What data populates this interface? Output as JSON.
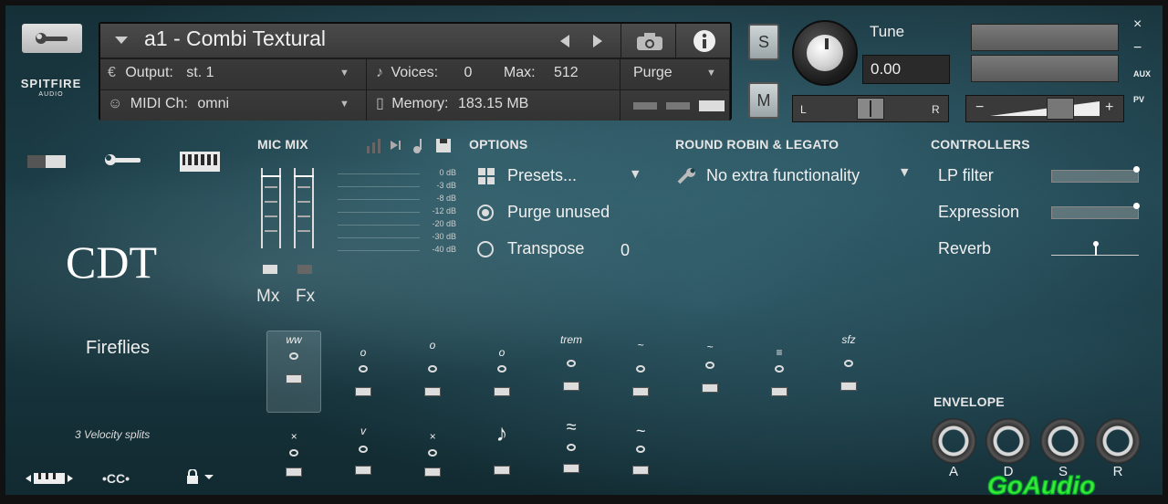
{
  "brand": {
    "name": "SPITFIRE",
    "sub": "AUDIO"
  },
  "header": {
    "instrument_name": "a1 - Combi Textural",
    "output_label": "Output:",
    "output_value": "st. 1",
    "voices_label": "Voices:",
    "voices_value": "0",
    "max_label": "Max:",
    "max_value": "512",
    "purge_label": "Purge",
    "midi_label": "MIDI Ch:",
    "midi_value": "omni",
    "memory_label": "Memory:",
    "memory_value": "183.15 MB"
  },
  "controls": {
    "solo": "S",
    "mute": "M",
    "tune_label": "Tune",
    "tune_value": "0.00",
    "pan_left": "L",
    "pan_right": "R",
    "vol_minus": "−",
    "vol_plus": "+",
    "aux": "AUX",
    "pv": "PV",
    "close": "×",
    "minimize": "−"
  },
  "instrument": {
    "logo_text": "CDT",
    "patch": "Fireflies",
    "velocity": "3 Velocity splits",
    "bottom_cc": "•CC•"
  },
  "mic_mix": {
    "title": "MIC MIX",
    "db_labels": [
      "0 dB",
      "-3 dB",
      "-8 dB",
      "-12 dB",
      "-20 dB",
      "-30 dB",
      "-40 dB"
    ],
    "channels": [
      "Mx",
      "Fx"
    ]
  },
  "options": {
    "title": "OPTIONS",
    "presets": "Presets...",
    "purge_unused": "Purge unused",
    "transpose": "Transpose",
    "transpose_value": "0"
  },
  "round_robin": {
    "title": "ROUND ROBIN & LEGATO",
    "value": "No extra functionality"
  },
  "controllers": {
    "title": "CONTROLLERS",
    "items": [
      {
        "label": "LP filter",
        "value": 1.0
      },
      {
        "label": "Expression",
        "value": 1.0
      },
      {
        "label": "Reverb",
        "value": 0.5
      }
    ]
  },
  "articulations": {
    "row1": [
      "ww",
      "o",
      "o",
      "o",
      "trem",
      "~",
      "~",
      "≡",
      "sfz"
    ],
    "row2": [
      "×",
      "v",
      "×",
      "♪",
      "≈",
      "~"
    ]
  },
  "envelope": {
    "title": "ENVELOPE",
    "knobs": [
      "A",
      "D",
      "S",
      "R"
    ]
  },
  "watermark": "GoAudio",
  "colors": {
    "accent_green": "#3de63a",
    "bg_teal": "#1c3e48"
  }
}
